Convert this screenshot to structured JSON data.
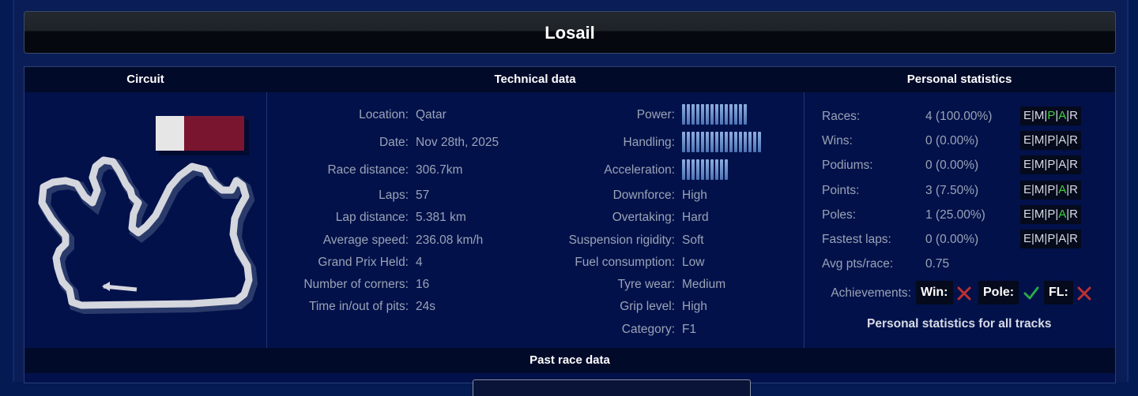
{
  "track_name": "Losail",
  "headers": {
    "circuit": "Circuit",
    "technical": "Technical data",
    "personal": "Personal statistics",
    "past": "Past race data"
  },
  "technical_left": [
    {
      "label": "Location:",
      "value": "Qatar"
    },
    {
      "label": "Date:",
      "value": "Nov 28th, 2025"
    },
    {
      "label": "Race distance:",
      "value": "306.7km"
    },
    {
      "label": "Laps:",
      "value": "57"
    },
    {
      "label": "Lap distance:",
      "value": "5.381 km"
    },
    {
      "label": "Average speed:",
      "value": "236.08 km/h"
    },
    {
      "label": "Grand Prix Held:",
      "value": "4"
    },
    {
      "label": "Number of corners:",
      "value": "16"
    },
    {
      "label": "Time in/out of pits:",
      "value": "24s"
    }
  ],
  "technical_right": [
    {
      "label": "Power:",
      "bar_segments": 14
    },
    {
      "label": "Handling:",
      "bar_segments": 17
    },
    {
      "label": "Acceleration:",
      "bar_segments": 10
    },
    {
      "label": "Downforce:",
      "value": "High"
    },
    {
      "label": "Overtaking:",
      "value": "Hard"
    },
    {
      "label": "Suspension rigidity:",
      "value": "Soft"
    },
    {
      "label": "Fuel consumption:",
      "value": "Low"
    },
    {
      "label": "Tyre wear:",
      "value": "Medium"
    },
    {
      "label": "Grip level:",
      "value": "High"
    },
    {
      "label": "Category:",
      "value": "F1"
    }
  ],
  "personal_stats": [
    {
      "label": "Races:",
      "value": "4 (100.00%)",
      "emp_active": [
        "P",
        "A"
      ]
    },
    {
      "label": "Wins:",
      "value": "0 (0.00%)",
      "emp_active": []
    },
    {
      "label": "Podiums:",
      "value": "0 (0.00%)",
      "emp_active": []
    },
    {
      "label": "Points:",
      "value": "3 (7.50%)",
      "emp_active": [
        "A"
      ]
    },
    {
      "label": "Poles:",
      "value": "1 (25.00%)",
      "emp_active": [
        "A"
      ]
    },
    {
      "label": "Fastest laps:",
      "value": "0 (0.00%)",
      "emp_active": []
    },
    {
      "label": "Avg pts/race:",
      "value": "0.75"
    }
  ],
  "emp_letters": [
    "E",
    "M",
    "P",
    "A",
    "R"
  ],
  "achievements": {
    "label": "Achievements:",
    "win": {
      "label": "Win:",
      "status": "cross-icon"
    },
    "pole": {
      "label": "Pole:",
      "status": "check-icon"
    },
    "fl": {
      "label": "FL:",
      "status": "cross-icon"
    }
  },
  "all_tracks_link": "Personal statistics for all tracks",
  "colors": {
    "active_letter": "#3fd23f",
    "flag_maroon": "#7a1530",
    "check": "#2aa84a",
    "cross": "#c03030"
  }
}
